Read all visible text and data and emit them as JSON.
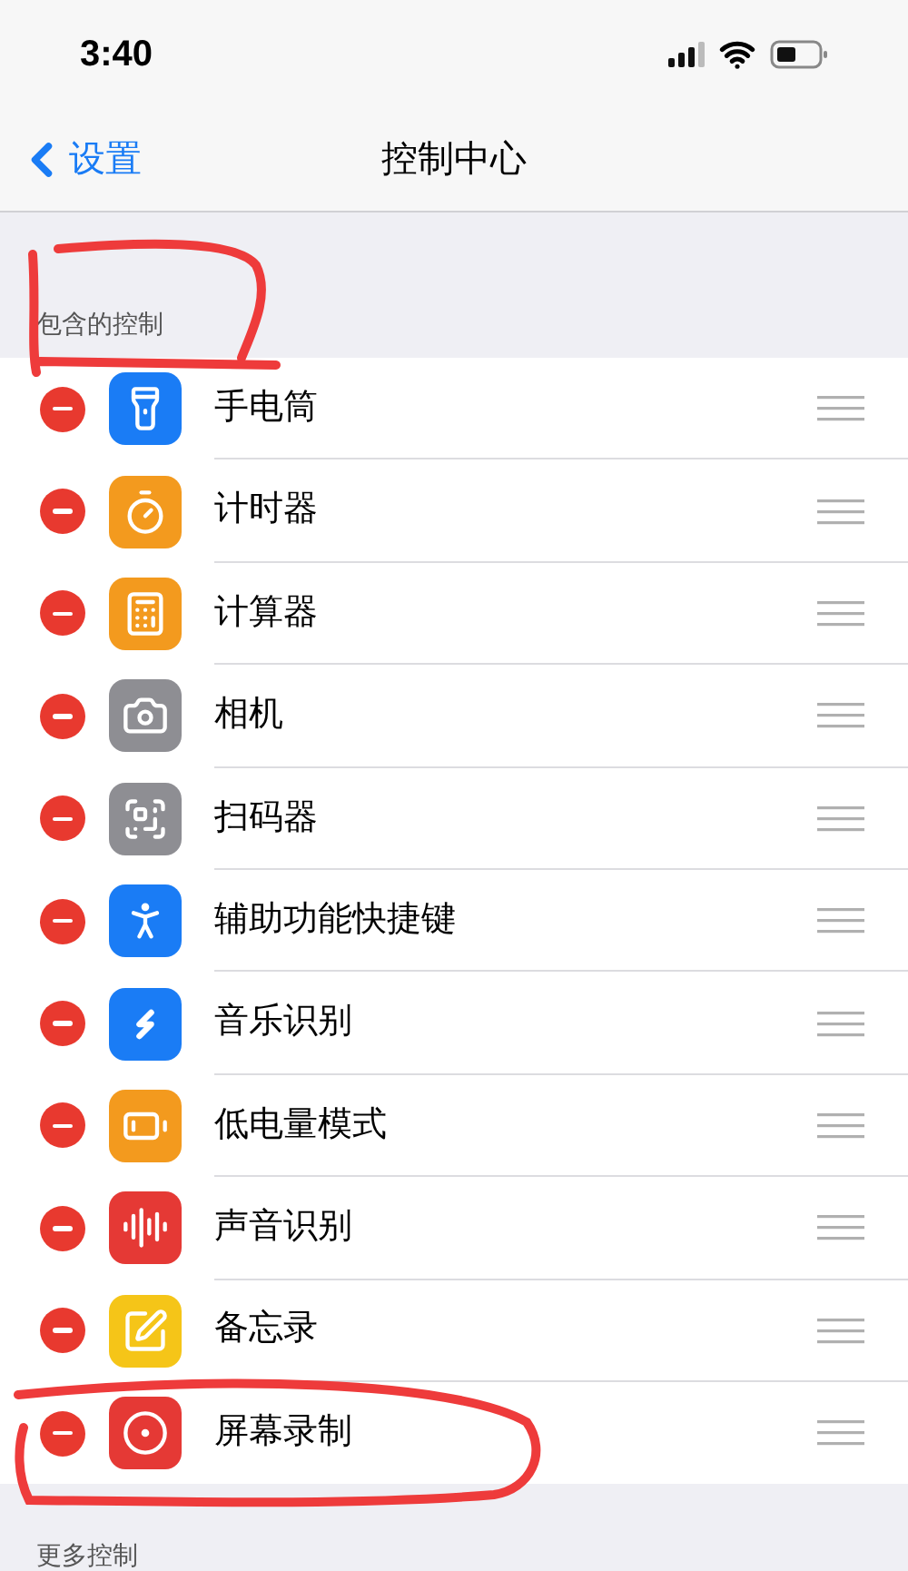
{
  "status_bar": {
    "time": "3:40"
  },
  "nav": {
    "back": "设置",
    "title": "控制中心"
  },
  "included": {
    "header": "包含的控制",
    "items": [
      {
        "label": "手电筒",
        "kind": "flashlight",
        "color": "#1a7cf5"
      },
      {
        "label": "计时器",
        "kind": "timer",
        "color": "#f39a1e"
      },
      {
        "label": "计算器",
        "kind": "calculator",
        "color": "#f39a1e"
      },
      {
        "label": "相机",
        "kind": "camera",
        "color": "#8e8e93"
      },
      {
        "label": "扫码器",
        "kind": "qrcode",
        "color": "#8e8e93"
      },
      {
        "label": "辅助功能快捷键",
        "kind": "accessibility",
        "color": "#1a7cf5"
      },
      {
        "label": "音乐识别",
        "kind": "music",
        "color": "#1a7cf5"
      },
      {
        "label": "低电量模式",
        "kind": "battery",
        "color": "#f39a1e"
      },
      {
        "label": "声音识别",
        "kind": "sound",
        "color": "#e53935"
      },
      {
        "label": "备忘录",
        "kind": "notes",
        "color": "#f5c518"
      },
      {
        "label": "屏幕录制",
        "kind": "record",
        "color": "#e53935"
      }
    ]
  },
  "more": {
    "header": "更多控制"
  }
}
